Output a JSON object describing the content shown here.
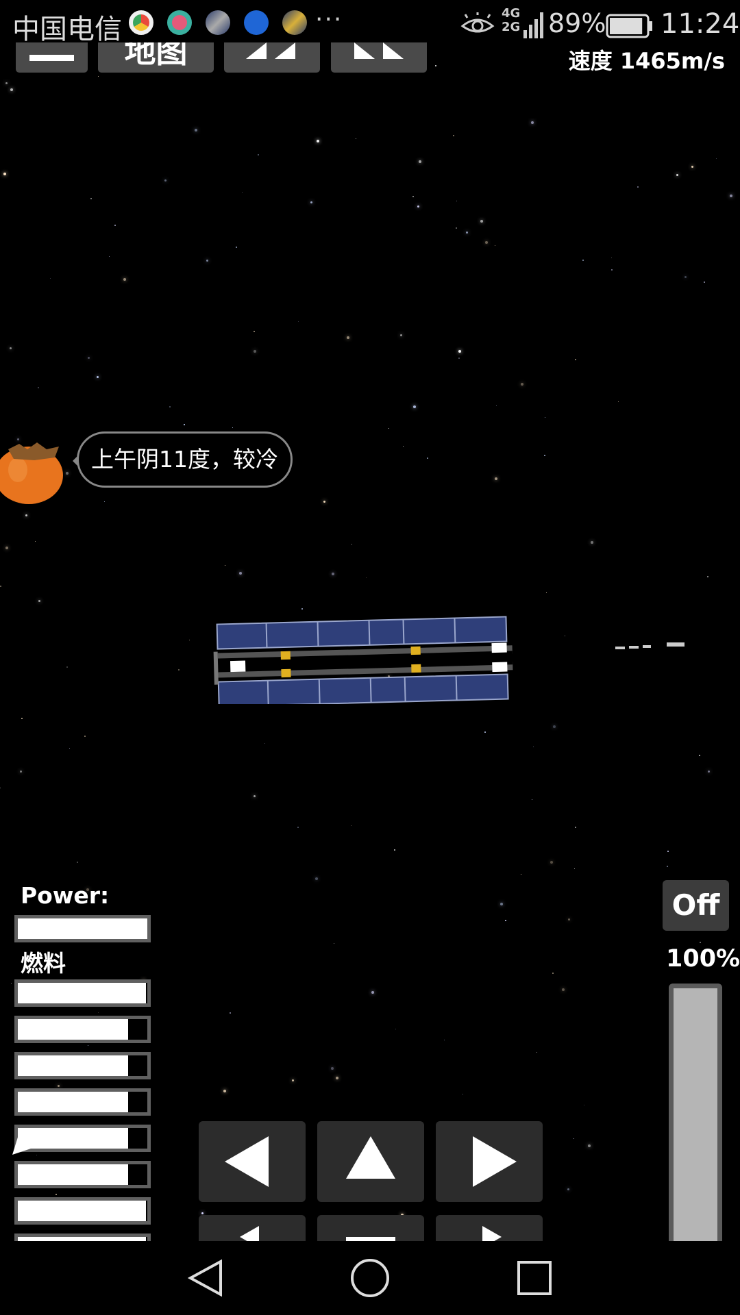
{
  "status_bar": {
    "carrier": "中国电信",
    "notification_icons": [
      "chrome-like-app-icon",
      "find-app-icon",
      "rocket-game-icon",
      "shield-security-icon",
      "rocket-game-icon"
    ],
    "more": "···",
    "network_type_top": "4G",
    "network_type_bottom": "2G",
    "battery_percent": "89%",
    "battery_level": 0.89,
    "time": "11:24"
  },
  "toolbar": {
    "menu_label": "—",
    "map_label": "地图",
    "rewind_icon": "rewind-icon",
    "fast_forward_icon": "fast-forward-icon",
    "speed": "速度 1465m/s"
  },
  "assistant": {
    "icon": "persimmon-icon",
    "message": "上午阴11度，较冷"
  },
  "gauges": {
    "power_label": "Power:",
    "power_level": 1.0,
    "fuel_label": "燃料",
    "fuel_levels": [
      0.99,
      0.85,
      0.85,
      0.85,
      0.85,
      0.85,
      0.99,
      0.99
    ]
  },
  "controls": {
    "engine_toggle": "Off",
    "throttle_label": "100%",
    "throttle_level": 1.0,
    "pad_icons": [
      "rotate-left-icon",
      "thrust-up-icon",
      "rotate-right-icon",
      "left-icon",
      "thrust-down-icon",
      "right-icon"
    ]
  },
  "nav": {
    "icons": [
      "back-icon",
      "home-icon",
      "recents-icon"
    ]
  },
  "colors": {
    "background": "#000000",
    "panel_button": "#2c2c2c",
    "gauge_frame": "#606060",
    "solar_panel": "#2f3f7a",
    "persimmon": "#e8741e"
  }
}
